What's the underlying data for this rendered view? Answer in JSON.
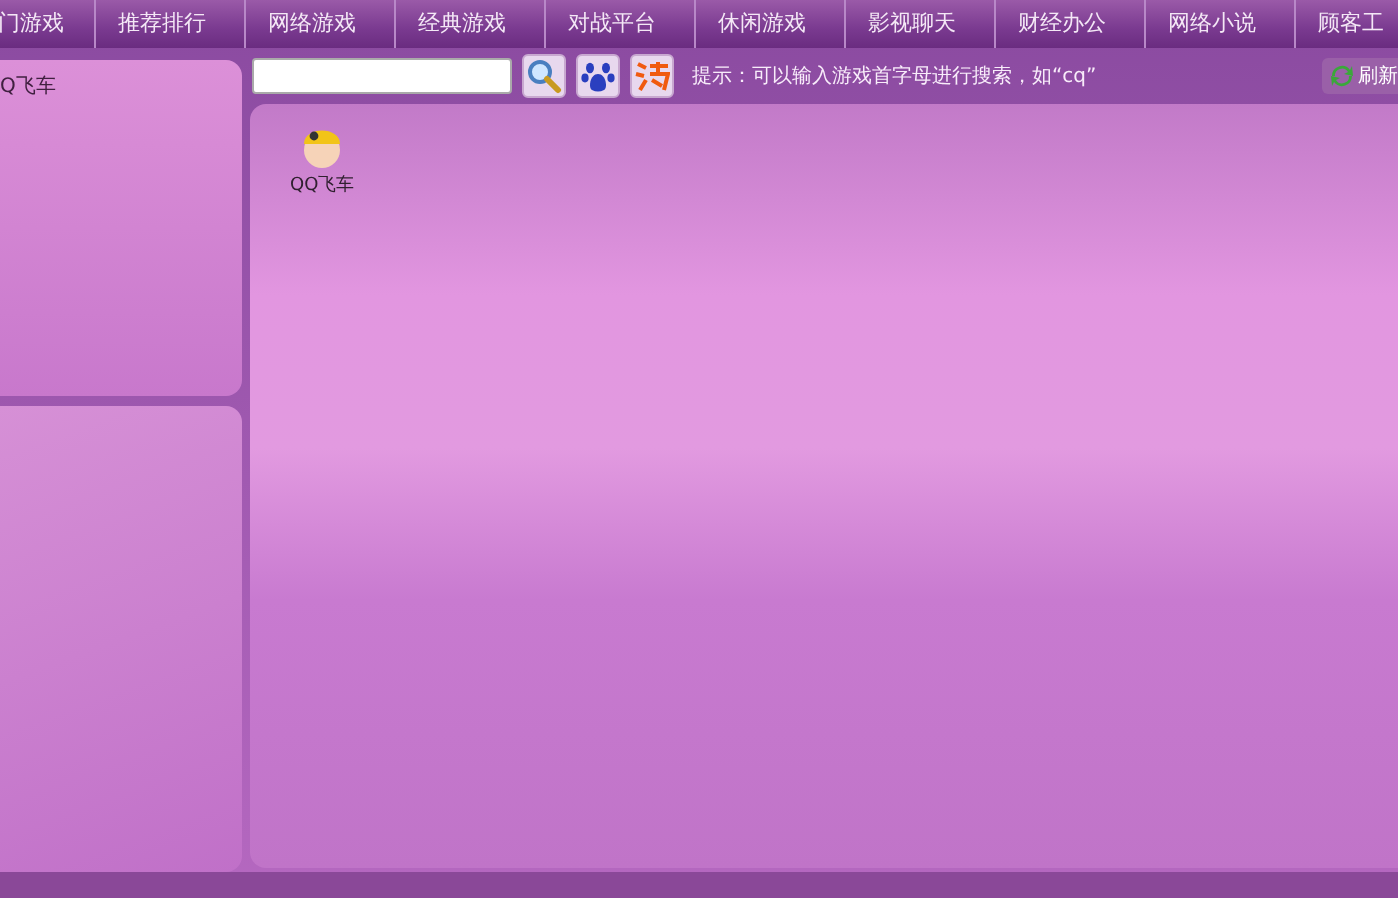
{
  "nav": {
    "tabs": [
      {
        "label": "门游戏"
      },
      {
        "label": "推荐排行"
      },
      {
        "label": "网络游戏"
      },
      {
        "label": "经典游戏"
      },
      {
        "label": "对战平台"
      },
      {
        "label": "休闲游戏"
      },
      {
        "label": "影视聊天"
      },
      {
        "label": "财经办公"
      },
      {
        "label": "网络小说"
      },
      {
        "label": "顾客工"
      }
    ]
  },
  "sidebar": {
    "items": [
      {
        "label": "Q飞车"
      }
    ]
  },
  "toolbar": {
    "hint": "提示：可以输入游戏首字母进行搜索，如“cq”",
    "refresh": "刷新"
  },
  "games": [
    {
      "label": "QQ飞车"
    }
  ]
}
